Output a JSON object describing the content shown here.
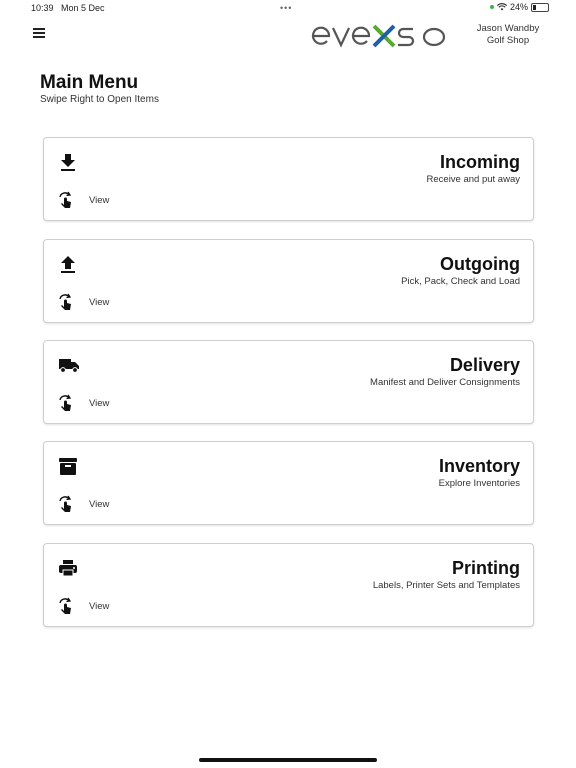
{
  "status_bar": {
    "time": "10:39",
    "date": "Mon 5 Dec",
    "dots": "•••",
    "battery": "24%"
  },
  "header": {
    "menu_icon": "hamburger-icon",
    "logo_text": "evexso",
    "user_name": "Jason Wandby",
    "company": "Golf Shop",
    "colors": {
      "logo_gray": "#555555",
      "logo_green": "#5aa832",
      "logo_blue": "#1f5fa8"
    }
  },
  "page": {
    "title": "Main Menu",
    "subtitle": "Swipe Right to Open Items"
  },
  "cards": [
    {
      "title": "Incoming",
      "subtitle": "Receive and put away",
      "icon": "download-icon",
      "view_label": "View"
    },
    {
      "title": "Outgoing",
      "subtitle": "Pick, Pack, Check and Load",
      "icon": "upload-icon",
      "view_label": "View"
    },
    {
      "title": "Delivery",
      "subtitle": "Manifest and Deliver Consignments",
      "icon": "truck-icon",
      "view_label": "View"
    },
    {
      "title": "Inventory",
      "subtitle": "Explore Inventories",
      "icon": "archive-box-icon",
      "view_label": "View"
    },
    {
      "title": "Printing",
      "subtitle": "Labels, Printer Sets and Templates",
      "icon": "printer-icon",
      "view_label": "View"
    }
  ]
}
